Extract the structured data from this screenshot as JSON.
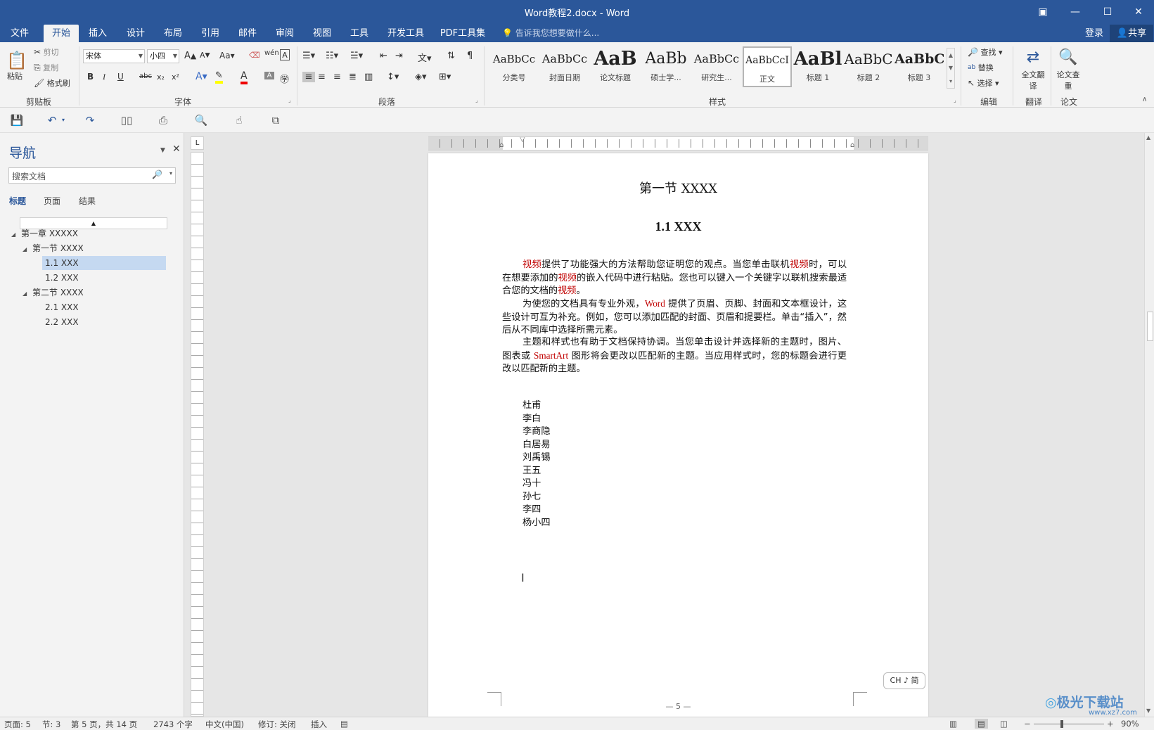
{
  "window": {
    "title": "Word教程2.docx - Word"
  },
  "tabs": [
    "文件",
    "开始",
    "插入",
    "设计",
    "布局",
    "引用",
    "邮件",
    "审阅",
    "视图",
    "工具",
    "开发工具",
    "PDF工具集"
  ],
  "tell_me": "告诉我您想要做什么...",
  "account": {
    "login": "登录",
    "share": "共享"
  },
  "clipboard": {
    "paste": "粘贴",
    "cut": "剪切",
    "copy": "复制",
    "format_painter": "格式刷",
    "label": "剪贴板"
  },
  "font": {
    "name": "宋体",
    "size": "小四",
    "label": "字体",
    "grow": "A",
    "shrink": "A",
    "case": "Aa",
    "bold": "B",
    "italic": "I",
    "underline": "U",
    "strike": "abc",
    "sub": "x₂",
    "sup": "x²"
  },
  "paragraph": {
    "label": "段落"
  },
  "styles": {
    "label": "样式",
    "items": [
      {
        "sample": "AaBbCc",
        "name": "分类号"
      },
      {
        "sample": "AaBbCc",
        "name": "封面日期"
      },
      {
        "sample": "AaB",
        "name": "论文标题"
      },
      {
        "sample": "AaBb",
        "name": "硕士学..."
      },
      {
        "sample": "AaBbCc",
        "name": "研究生..."
      },
      {
        "sample": "AaBbCcI",
        "name": "正文"
      },
      {
        "sample": "AaBl",
        "name": "标题 1"
      },
      {
        "sample": "AaBbC",
        "name": "标题 2"
      },
      {
        "sample": "AaBbC",
        "name": "标题 3"
      }
    ]
  },
  "editing": {
    "find": "查找",
    "replace": "替换",
    "select": "选择",
    "label": "编辑"
  },
  "translate": {
    "full": "全文翻译",
    "label": "翻译"
  },
  "paper": {
    "check": "论文查重",
    "label": "论文"
  },
  "nav": {
    "title": "导航",
    "search_placeholder": "搜索文档",
    "tabs": [
      "标题",
      "页面",
      "结果"
    ],
    "tree": [
      {
        "label": "第一章 XXXXX",
        "level": 0
      },
      {
        "label": "第一节 XXXX",
        "level": 1
      },
      {
        "label": "1.1 XXX",
        "level": 2,
        "selected": true
      },
      {
        "label": "1.2 XXX",
        "level": 2
      },
      {
        "label": "第二节 XXXX",
        "level": 1
      },
      {
        "label": "2.1 XXX",
        "level": 2
      },
      {
        "label": "2.2 XXX",
        "level": 2
      }
    ]
  },
  "document": {
    "heading1": "第一节  XXXX",
    "heading2": "1.1 XXX",
    "p1": [
      "视频",
      "提供了功能强大的方法帮助您证明您的观点。当您单击联机",
      "视频",
      "时，可以在想要添加的",
      "视频",
      "的嵌入代码中进行粘贴。您也可以键入一个关键字以联机搜索最适合您的文档的",
      "视频",
      "。"
    ],
    "p2": [
      "为使您的文档具有专业外观，",
      "Word",
      "提供了页眉、页脚、封面和文本框设计，这些设计可互为补充。例如，您可以添加匹配的封面、页眉和提要栏。单击“插入”，然后从不同库中选择所需元素。"
    ],
    "p3": [
      "主题和样式也有助于文档保持协调。当您单击设计并选择新的主题时，图片、图表或 ",
      "SmartArt",
      "图形将会更改以匹配新的主题。当应用样式时，您的标题会进行更改以匹配新的主题。"
    ],
    "names": [
      "杜甫",
      "李白",
      "李商隐",
      "白居易",
      "刘禹锡",
      "王五",
      "冯十",
      "孙七",
      "李四",
      "杨小四"
    ],
    "page_num": "— 5 —",
    "ime": "CH ♪ 简"
  },
  "status": {
    "page": "页面: 5",
    "section": "节: 3",
    "pages": "第 5 页，共 14 页",
    "words": "2743 个字",
    "lang": "中文(中国)",
    "track": "修订: 关闭",
    "mode": "插入",
    "zoom": "90%"
  },
  "watermark": "极光下载站",
  "watermark_url": "www.xz7.com"
}
